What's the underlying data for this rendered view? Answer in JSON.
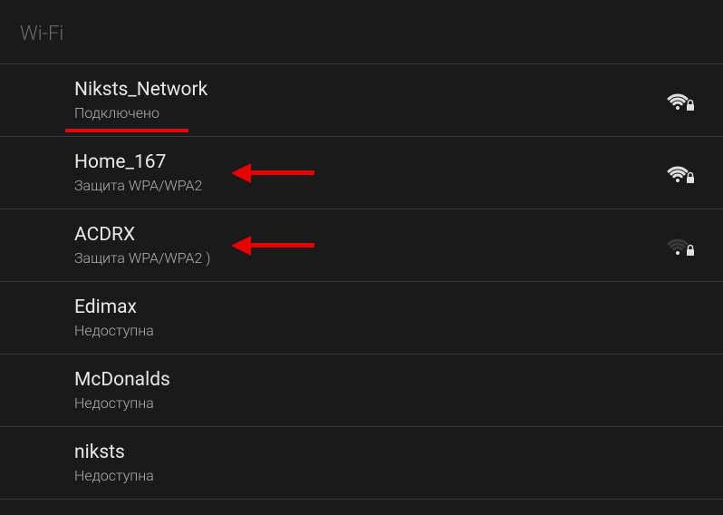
{
  "header": {
    "title": "Wi-Fi"
  },
  "networks": [
    {
      "name": "Niksts_Network",
      "status": "Подключено",
      "signal": 4,
      "locked": true,
      "underline": true,
      "arrow": false
    },
    {
      "name": "Home_167",
      "status": "Защита WPA/WPA2",
      "signal": 4,
      "locked": true,
      "underline": false,
      "arrow": true
    },
    {
      "name": "ACDRX",
      "status": "Защита WPA/WPA2 )",
      "signal": 1,
      "locked": true,
      "underline": false,
      "arrow": true
    },
    {
      "name": "Edimax",
      "status": "Недоступна",
      "signal": 0,
      "locked": false,
      "underline": false,
      "arrow": false
    },
    {
      "name": "McDonalds",
      "status": "Недоступна",
      "signal": 0,
      "locked": false,
      "underline": false,
      "arrow": false
    },
    {
      "name": "niksts",
      "status": "Недоступна",
      "signal": 0,
      "locked": false,
      "underline": false,
      "arrow": false
    }
  ]
}
